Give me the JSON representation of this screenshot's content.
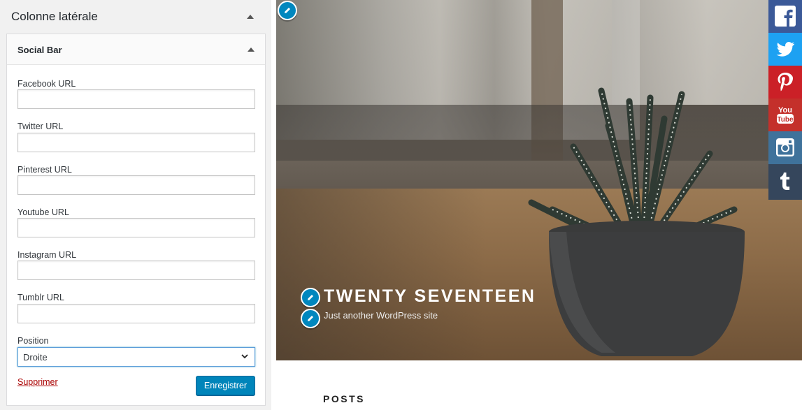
{
  "panel": {
    "title": "Colonne latérale",
    "widget": {
      "title": "Social Bar",
      "fields": [
        {
          "label": "Facebook URL",
          "value": ""
        },
        {
          "label": "Twitter URL",
          "value": ""
        },
        {
          "label": "Pinterest URL",
          "value": ""
        },
        {
          "label": "Youtube URL",
          "value": ""
        },
        {
          "label": "Instagram URL",
          "value": ""
        },
        {
          "label": "Tumblr URL",
          "value": ""
        }
      ],
      "position": {
        "label": "Position",
        "selected": "Droite"
      },
      "delete_label": "Supprimer",
      "save_label": "Enregistrer"
    }
  },
  "preview": {
    "site_title": "TWENTY SEVENTEEN",
    "tagline": "Just another WordPress site",
    "posts_heading": "POSTS"
  },
  "social_bar": [
    {
      "name": "facebook",
      "icon": "facebook-icon",
      "color": "#3b5998"
    },
    {
      "name": "twitter",
      "icon": "twitter-icon",
      "color": "#1da1f2"
    },
    {
      "name": "pinterest",
      "icon": "pinterest-icon",
      "color": "#cb2027"
    },
    {
      "name": "youtube",
      "icon": "youtube-icon",
      "color": "#c4302b"
    },
    {
      "name": "instagram",
      "icon": "instagram-icon",
      "color": "#3f729b"
    },
    {
      "name": "tumblr",
      "icon": "tumblr-icon",
      "color": "#35465c"
    }
  ],
  "colors": {
    "accent": "#0085ba",
    "edit_shortcut": "#0087be",
    "delete_link": "#aa0000"
  }
}
